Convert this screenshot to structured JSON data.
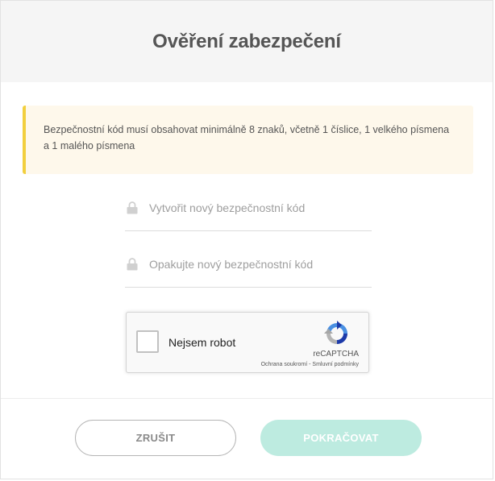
{
  "dialog": {
    "title": "Ověření zabezpečení"
  },
  "notice": {
    "text": "Bezpečnostní kód musí obsahovat minimálně 8 znaků, včetně 1 číslice, 1 velkého písmena a 1 malého písmena",
    "accent_color": "#f2cf3e",
    "background_color": "#fef8eb"
  },
  "form": {
    "new_code": {
      "placeholder": "Vytvořit nový bezpečnostní kód",
      "value": "",
      "icon": "lock-icon"
    },
    "repeat_code": {
      "placeholder": "Opakujte nový bezpečnostní kód",
      "value": "",
      "icon": "lock-icon"
    }
  },
  "recaptcha": {
    "checkbox_label": "Nejsem robot",
    "checked": false,
    "brand": "reCAPTCHA",
    "privacy_link": "Ochrana soukromí",
    "separator": " - ",
    "terms_link": "Smluvní podmínky",
    "icon": "recaptcha-logo-icon"
  },
  "actions": {
    "cancel_label": "ZRUŠIT",
    "continue_label": "POKRAČOVAT",
    "continue_color": "#bdebe0"
  }
}
